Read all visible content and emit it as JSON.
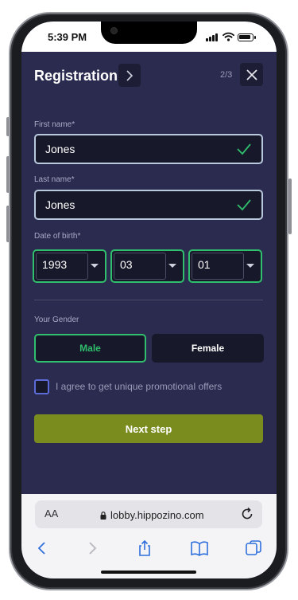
{
  "status": {
    "time": "5:39 PM"
  },
  "header": {
    "title": "Registration",
    "step": "2/3"
  },
  "first_name": {
    "label": "First name*",
    "value": "Jones"
  },
  "last_name": {
    "label": "Last name*",
    "value": "Jones"
  },
  "dob": {
    "label": "Date of birth*",
    "year": "1993",
    "month": "03",
    "day": "01"
  },
  "gender": {
    "label": "Your Gender",
    "options": [
      "Male",
      "Female"
    ],
    "selected": "Male"
  },
  "promo": {
    "label": "I agree to get unique promotional offers",
    "checked": false
  },
  "next_button": {
    "label": "Next step"
  },
  "browser": {
    "aa_label": "AA",
    "url": "lobby.hippozino.com"
  },
  "colors": {
    "background": "#2b2b4f",
    "field_bg": "#171829",
    "accent_green": "#2fbf6d",
    "cta": "#7a8c1e",
    "checkbox_border": "#5d6bd8"
  }
}
